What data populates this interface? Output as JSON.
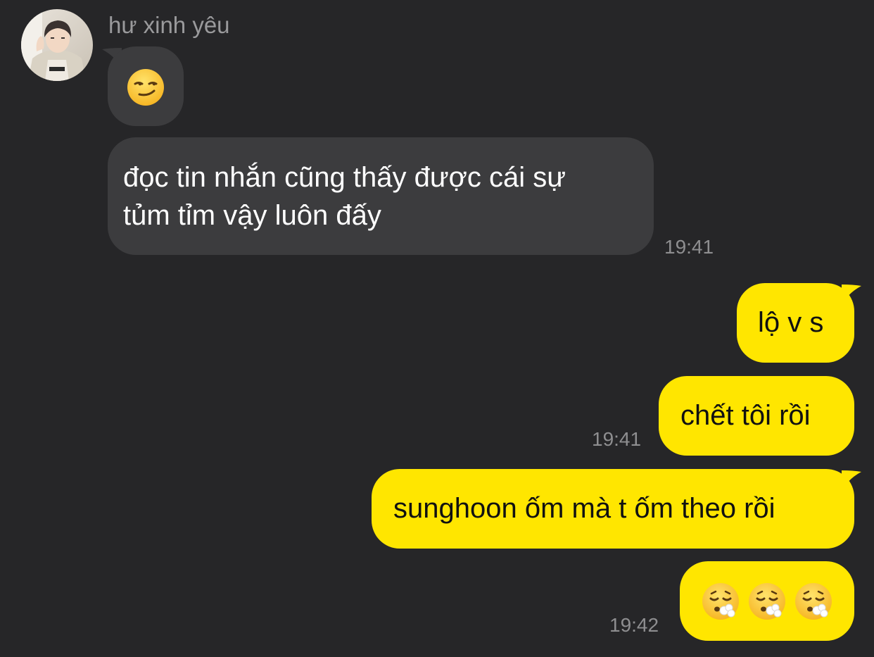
{
  "chat": {
    "sender_name": "hư xinh yêu",
    "colors": {
      "background": "#262628",
      "incoming_bubble": "#3c3c3e",
      "outgoing_bubble": "#ffe600",
      "timestamp": "#8e8e90",
      "sender_name": "#9a9a9c"
    },
    "messages": [
      {
        "direction": "incoming",
        "type": "emoji",
        "emoji": "smirking-face"
      },
      {
        "direction": "incoming",
        "type": "text",
        "line1": "đọc tin nhắn cũng thấy được cái sự",
        "line2": "tủm tỉm vậy luôn đấy",
        "time": "19:41"
      },
      {
        "direction": "outgoing",
        "type": "text",
        "text": "lộ v s"
      },
      {
        "direction": "outgoing",
        "type": "text",
        "text": "chết tôi rồi",
        "time": "19:41"
      },
      {
        "direction": "outgoing",
        "type": "text",
        "text": "sunghoon ốm mà t ốm theo rồi"
      },
      {
        "direction": "outgoing",
        "type": "emoji",
        "emoji": "face-exhaling",
        "count": 3,
        "time": "19:42"
      }
    ]
  }
}
